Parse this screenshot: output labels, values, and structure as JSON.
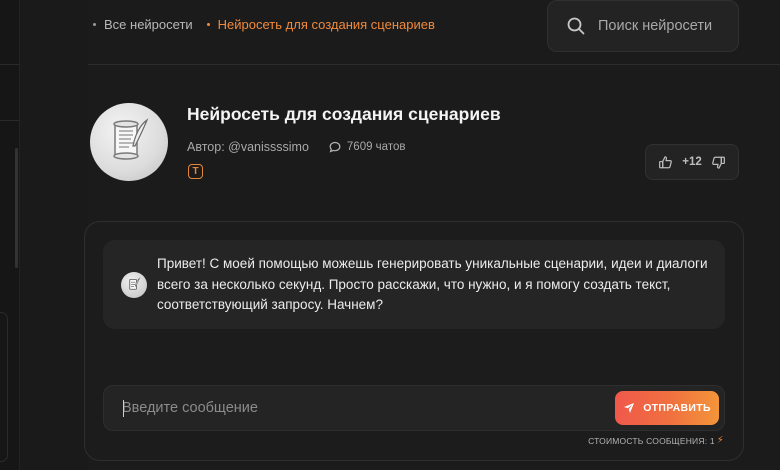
{
  "breadcrumbs": [
    {
      "label": "Все нейросети"
    },
    {
      "label": "Нейросеть для создания сценариев"
    }
  ],
  "search": {
    "placeholder": "Поиск нейросети",
    "icon": "search-icon"
  },
  "bot": {
    "title": "Нейросеть для создания сценариев",
    "author": "Автор: @vanissssimo",
    "chats": "7609 чатов",
    "type_badge": "T",
    "votes": "+12"
  },
  "chat": {
    "message": "Привет! С моей помощью можешь генерировать уникальные сценарии, идеи и диалоги всего за несколько секунд. Просто расскажи, что нужно, и я помогу создать текст, соответствующий запросу. Начнем?",
    "input_placeholder": "Введите сообщение",
    "send_label": "ОТПРАВИТЬ",
    "cost_label": "СТОИМОСТЬ СООБЩЕНИЯ: 1"
  },
  "colors": {
    "accent": "#f08a3c",
    "background": "#1a1a1a",
    "button_gradient_start": "#f0584b",
    "button_gradient_end": "#f3953a"
  }
}
